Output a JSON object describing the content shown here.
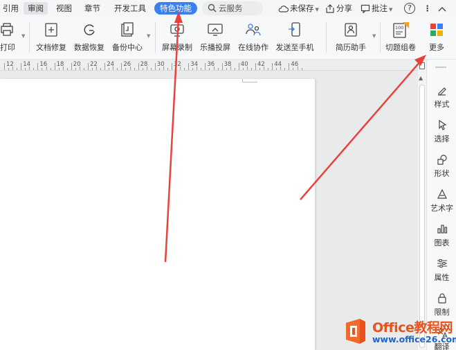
{
  "tabs": [
    {
      "label": "引用",
      "key": "quote"
    },
    {
      "label": "审阅",
      "key": "review"
    },
    {
      "label": "视图",
      "key": "view"
    },
    {
      "label": "章节",
      "key": "chapter"
    },
    {
      "label": "开发工具",
      "key": "devtools"
    },
    {
      "label": "特色功能",
      "key": "special",
      "active": true
    }
  ],
  "search": {
    "label": "云服务"
  },
  "header_right": {
    "unsaved": "未保存",
    "share": "分享",
    "comment": "批注",
    "help": "?",
    "more": "⋮",
    "collapse": "︿"
  },
  "toolbar": {
    "print": "打印",
    "doc_repair": "文档修复",
    "data_recovery": "数据恢复",
    "backup_center": "备份中心",
    "screen_record": "屏幕录制",
    "cast_screen": "乐播投屏",
    "online_collab": "在线协作",
    "send_to_phone": "发送至手机",
    "resume_helper": "简历助手",
    "question_paper": "切题组卷",
    "more": "更多"
  },
  "ruler": {
    "labels": [
      "12",
      "14",
      "16",
      "18",
      "20",
      "22",
      "24",
      "26",
      "28",
      "30",
      "32",
      "34",
      "36",
      "38",
      "40",
      "42",
      "44",
      "46"
    ]
  },
  "right_panel": [
    {
      "label": "样式",
      "icon": "brush-icon"
    },
    {
      "label": "选择",
      "icon": "cursor-icon"
    },
    {
      "label": "形状",
      "icon": "shapes-icon"
    },
    {
      "label": "艺术字",
      "icon": "wordart-icon"
    },
    {
      "label": "图表",
      "icon": "chart-icon"
    },
    {
      "label": "属性",
      "icon": "sliders-icon"
    },
    {
      "label": "限制",
      "icon": "lock-icon"
    },
    {
      "label": "翻译",
      "icon": "translate-icon"
    }
  ],
  "watermark": {
    "title": "Office教程网",
    "url": "www.office26.com"
  },
  "colors": {
    "accent": "#3b7ff0",
    "arrow": "#e8423a",
    "watermark_orange": "#e8531d",
    "watermark_blue": "#1f64c8"
  }
}
